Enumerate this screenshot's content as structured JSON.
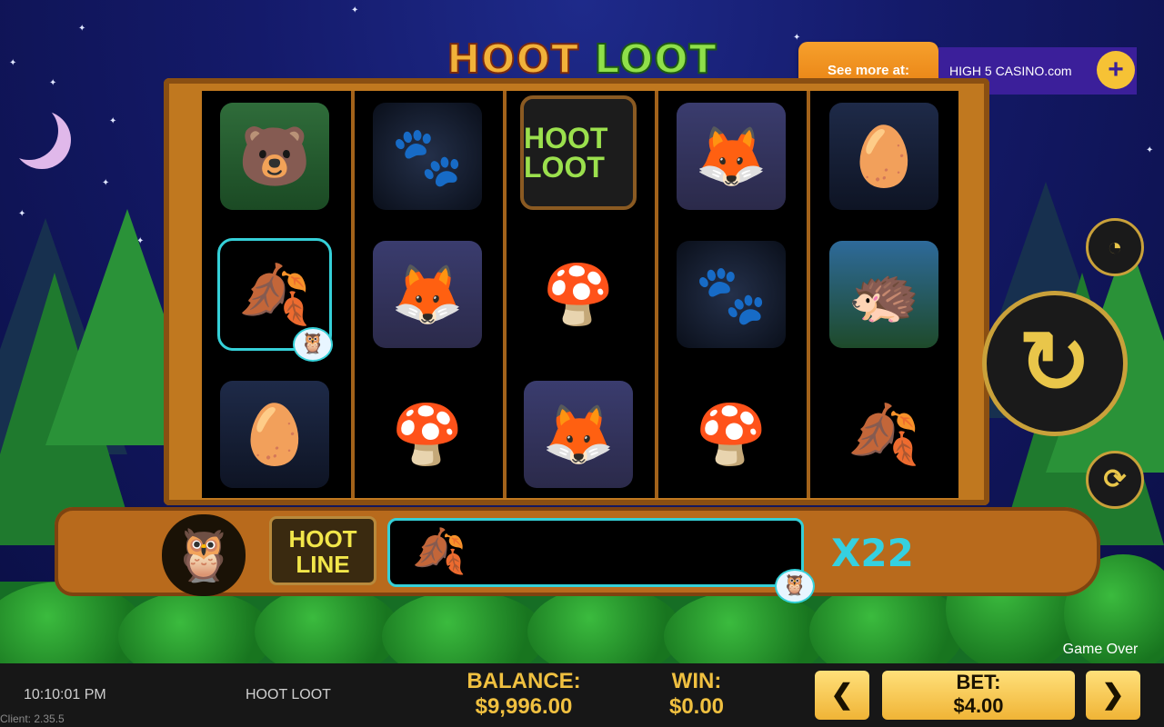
{
  "game": {
    "title_part1": "HOOT",
    "title_part2": "LOOT",
    "logo_symbol_text": "HOOT LOOT"
  },
  "promo": {
    "see_more_label": "See more at:",
    "brand": "HIGH 5 CASINO.com",
    "plus_label": "+"
  },
  "reels": [
    [
      "bear",
      "leaf",
      "nest"
    ],
    [
      "paw",
      "fox",
      "mushroom"
    ],
    [
      "logo",
      "mushroom",
      "fox"
    ],
    [
      "fox",
      "paw",
      "mushroom"
    ],
    [
      "nest",
      "hedgehog",
      "leaf"
    ]
  ],
  "hoot_line": {
    "label_line1": "HOOT",
    "label_line2": "LINE",
    "symbol": "leaf",
    "multiplier": "X22"
  },
  "controls": {
    "speed_icon": "speedometer-icon",
    "spin_icon": "spin-arrow-icon",
    "autoplay_icon": "autoplay-icon"
  },
  "status": {
    "game_over": "Game Over"
  },
  "bottom_bar": {
    "time": "10:10:01 PM",
    "client_version": "Client: 2.35.5",
    "game_name": "HOOT LOOT",
    "balance_label": "BALANCE:",
    "balance_value": "$9,996.00",
    "win_label": "WIN:",
    "win_value": "$0.00",
    "bet_label": "BET:",
    "bet_value": "$4.00",
    "prev_label": "❮",
    "next_label": "❯"
  },
  "colors": {
    "accent_cyan": "#35d0d8",
    "gold": "#f0c040",
    "wood": "#c0781f"
  }
}
